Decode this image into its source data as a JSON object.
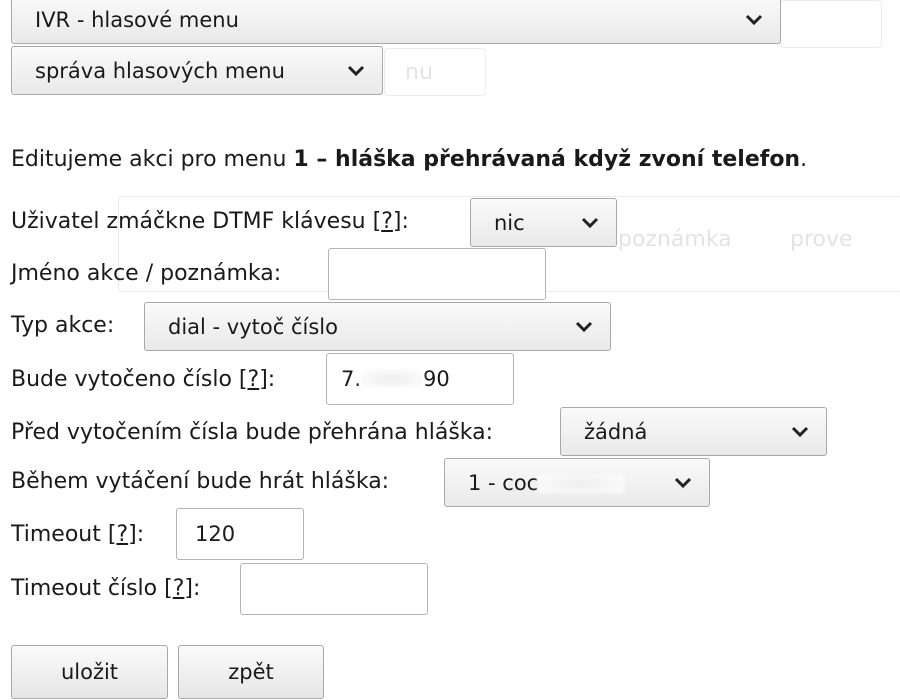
{
  "background_ghost": {
    "select_1": "",
    "select_2": "nu",
    "header_1": "poznámka",
    "header_2": "prove"
  },
  "nav": {
    "module_select": "IVR - hlasové menu",
    "section_select": "správa hlasových menu"
  },
  "intro": {
    "prefix": "Editujeme akci pro menu ",
    "menu_name": "1 – hláška přehrávaná když zvoní telefon",
    "suffix": "."
  },
  "help_marker": "?",
  "form": {
    "dtmf": {
      "label_before": "Uživatel zmáčkne DTMF klávesu [",
      "label_after": "]:",
      "value": "nic"
    },
    "action_name": {
      "label": "Jméno akce / poznámka:",
      "value": ""
    },
    "action_type": {
      "label": "Typ akce:",
      "value": "dial - vytoč číslo"
    },
    "number": {
      "label_before": "Bude vytočeno číslo [",
      "label_after": "]:",
      "value_start": "7.",
      "value_end": "90"
    },
    "before_announce": {
      "label": "Před vytočením čísla bude přehrána hláška:",
      "value": "žádná"
    },
    "during_announce": {
      "label": "Během vytáčení bude hrát hláška:",
      "value": "1 - coc"
    },
    "timeout": {
      "label_before": "Timeout [",
      "label_after": "]:",
      "value": "120"
    },
    "timeout_number": {
      "label_before": "Timeout číslo [",
      "label_after": "]:",
      "value": ""
    }
  },
  "buttons": {
    "save": "uložit",
    "back": "zpět"
  },
  "icons": {
    "dropdown": "chevron-down-icon"
  }
}
